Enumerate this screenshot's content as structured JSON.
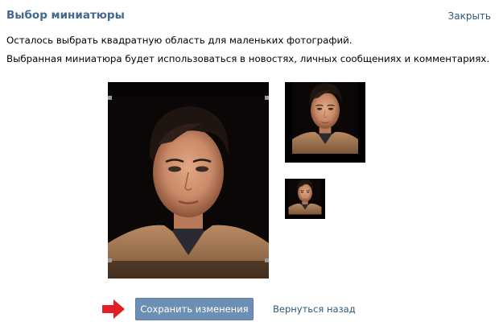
{
  "dialog": {
    "title": "Выбор миниатюры",
    "close_label": "Закрыть"
  },
  "instructions": {
    "line1": "Осталось выбрать квадратную область для маленьких фотографий.",
    "line2": "Выбранная миниатюра будет использоваться в новостях, личных сообщениях и комментариях."
  },
  "actions": {
    "save_label": "Сохранить изменения",
    "back_label": "Вернуться назад"
  },
  "icons": {
    "pointer": "red-arrow-icon"
  },
  "colors": {
    "title": "#45688e",
    "link": "#2b587a",
    "button": "#6d8fb3",
    "arrow": "#e41e25"
  }
}
